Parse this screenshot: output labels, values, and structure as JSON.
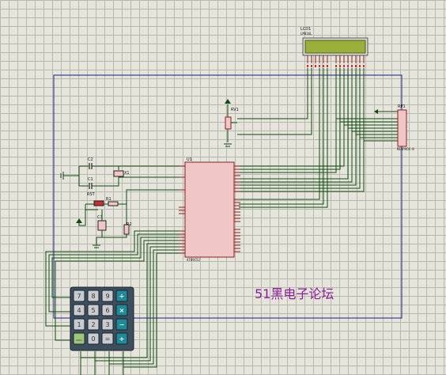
{
  "lcd": {
    "ref": "LCD1",
    "part": "LM016L"
  },
  "pot": {
    "ref": "RV1"
  },
  "resistor_pack": {
    "ref": "RP1",
    "part": "RESPACK-8"
  },
  "mcu": {
    "ref": "U1",
    "part": "AT89C52"
  },
  "capacitors": [
    {
      "ref": "C2"
    },
    {
      "ref": "C1"
    },
    {
      "ref": "C3"
    }
  ],
  "crystal": {
    "ref": "X1"
  },
  "resistors": [
    {
      "ref": "R1"
    },
    {
      "ref": "R2"
    }
  ],
  "reset_button": {
    "ref": "RST"
  },
  "keypad": {
    "rows": [
      [
        "7",
        "8",
        "9",
        "÷"
      ],
      [
        "4",
        "5",
        "6",
        "×"
      ],
      [
        "1",
        "2",
        "3",
        "−"
      ],
      [
        "ON/C",
        "0",
        "=",
        "+"
      ]
    ]
  },
  "watermark": "51黑电子论坛",
  "colors": {
    "background": "#e6e5dc",
    "grid": "#b9b8b0",
    "wire": "#0f4a0f",
    "border": "#1a1a8c",
    "chip": "#f1c6c6",
    "lcd_screen": "#98b03a",
    "watermark": "#8a1a9a"
  }
}
